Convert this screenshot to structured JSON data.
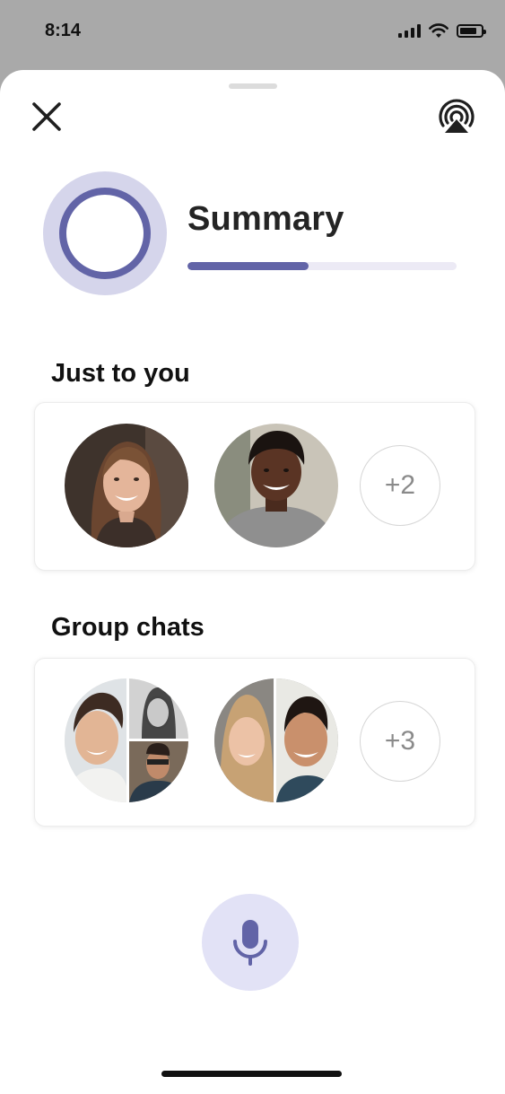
{
  "status_bar": {
    "time": "8:14",
    "icons": [
      "cellular-signal-icon",
      "wifi-icon",
      "battery-icon"
    ]
  },
  "header": {
    "close_icon": "close-icon",
    "airplay_icon": "airplay-icon"
  },
  "summary": {
    "title": "Summary",
    "progress_fraction": 0.45,
    "accent_color": "#6264a7",
    "ring_outer_color": "#d5d5eb"
  },
  "sections": {
    "just_to_you": {
      "heading": "Just to you",
      "avatars": [
        "woman-long-brown-hair",
        "young-man-gray-shirt"
      ],
      "more_count": "+2"
    },
    "group_chats": {
      "heading": "Group chats",
      "groups": [
        "group-three-people",
        "group-two-people"
      ],
      "more_count": "+3"
    }
  },
  "mic": {
    "icon": "microphone-icon",
    "background": "#e2e2f6"
  }
}
